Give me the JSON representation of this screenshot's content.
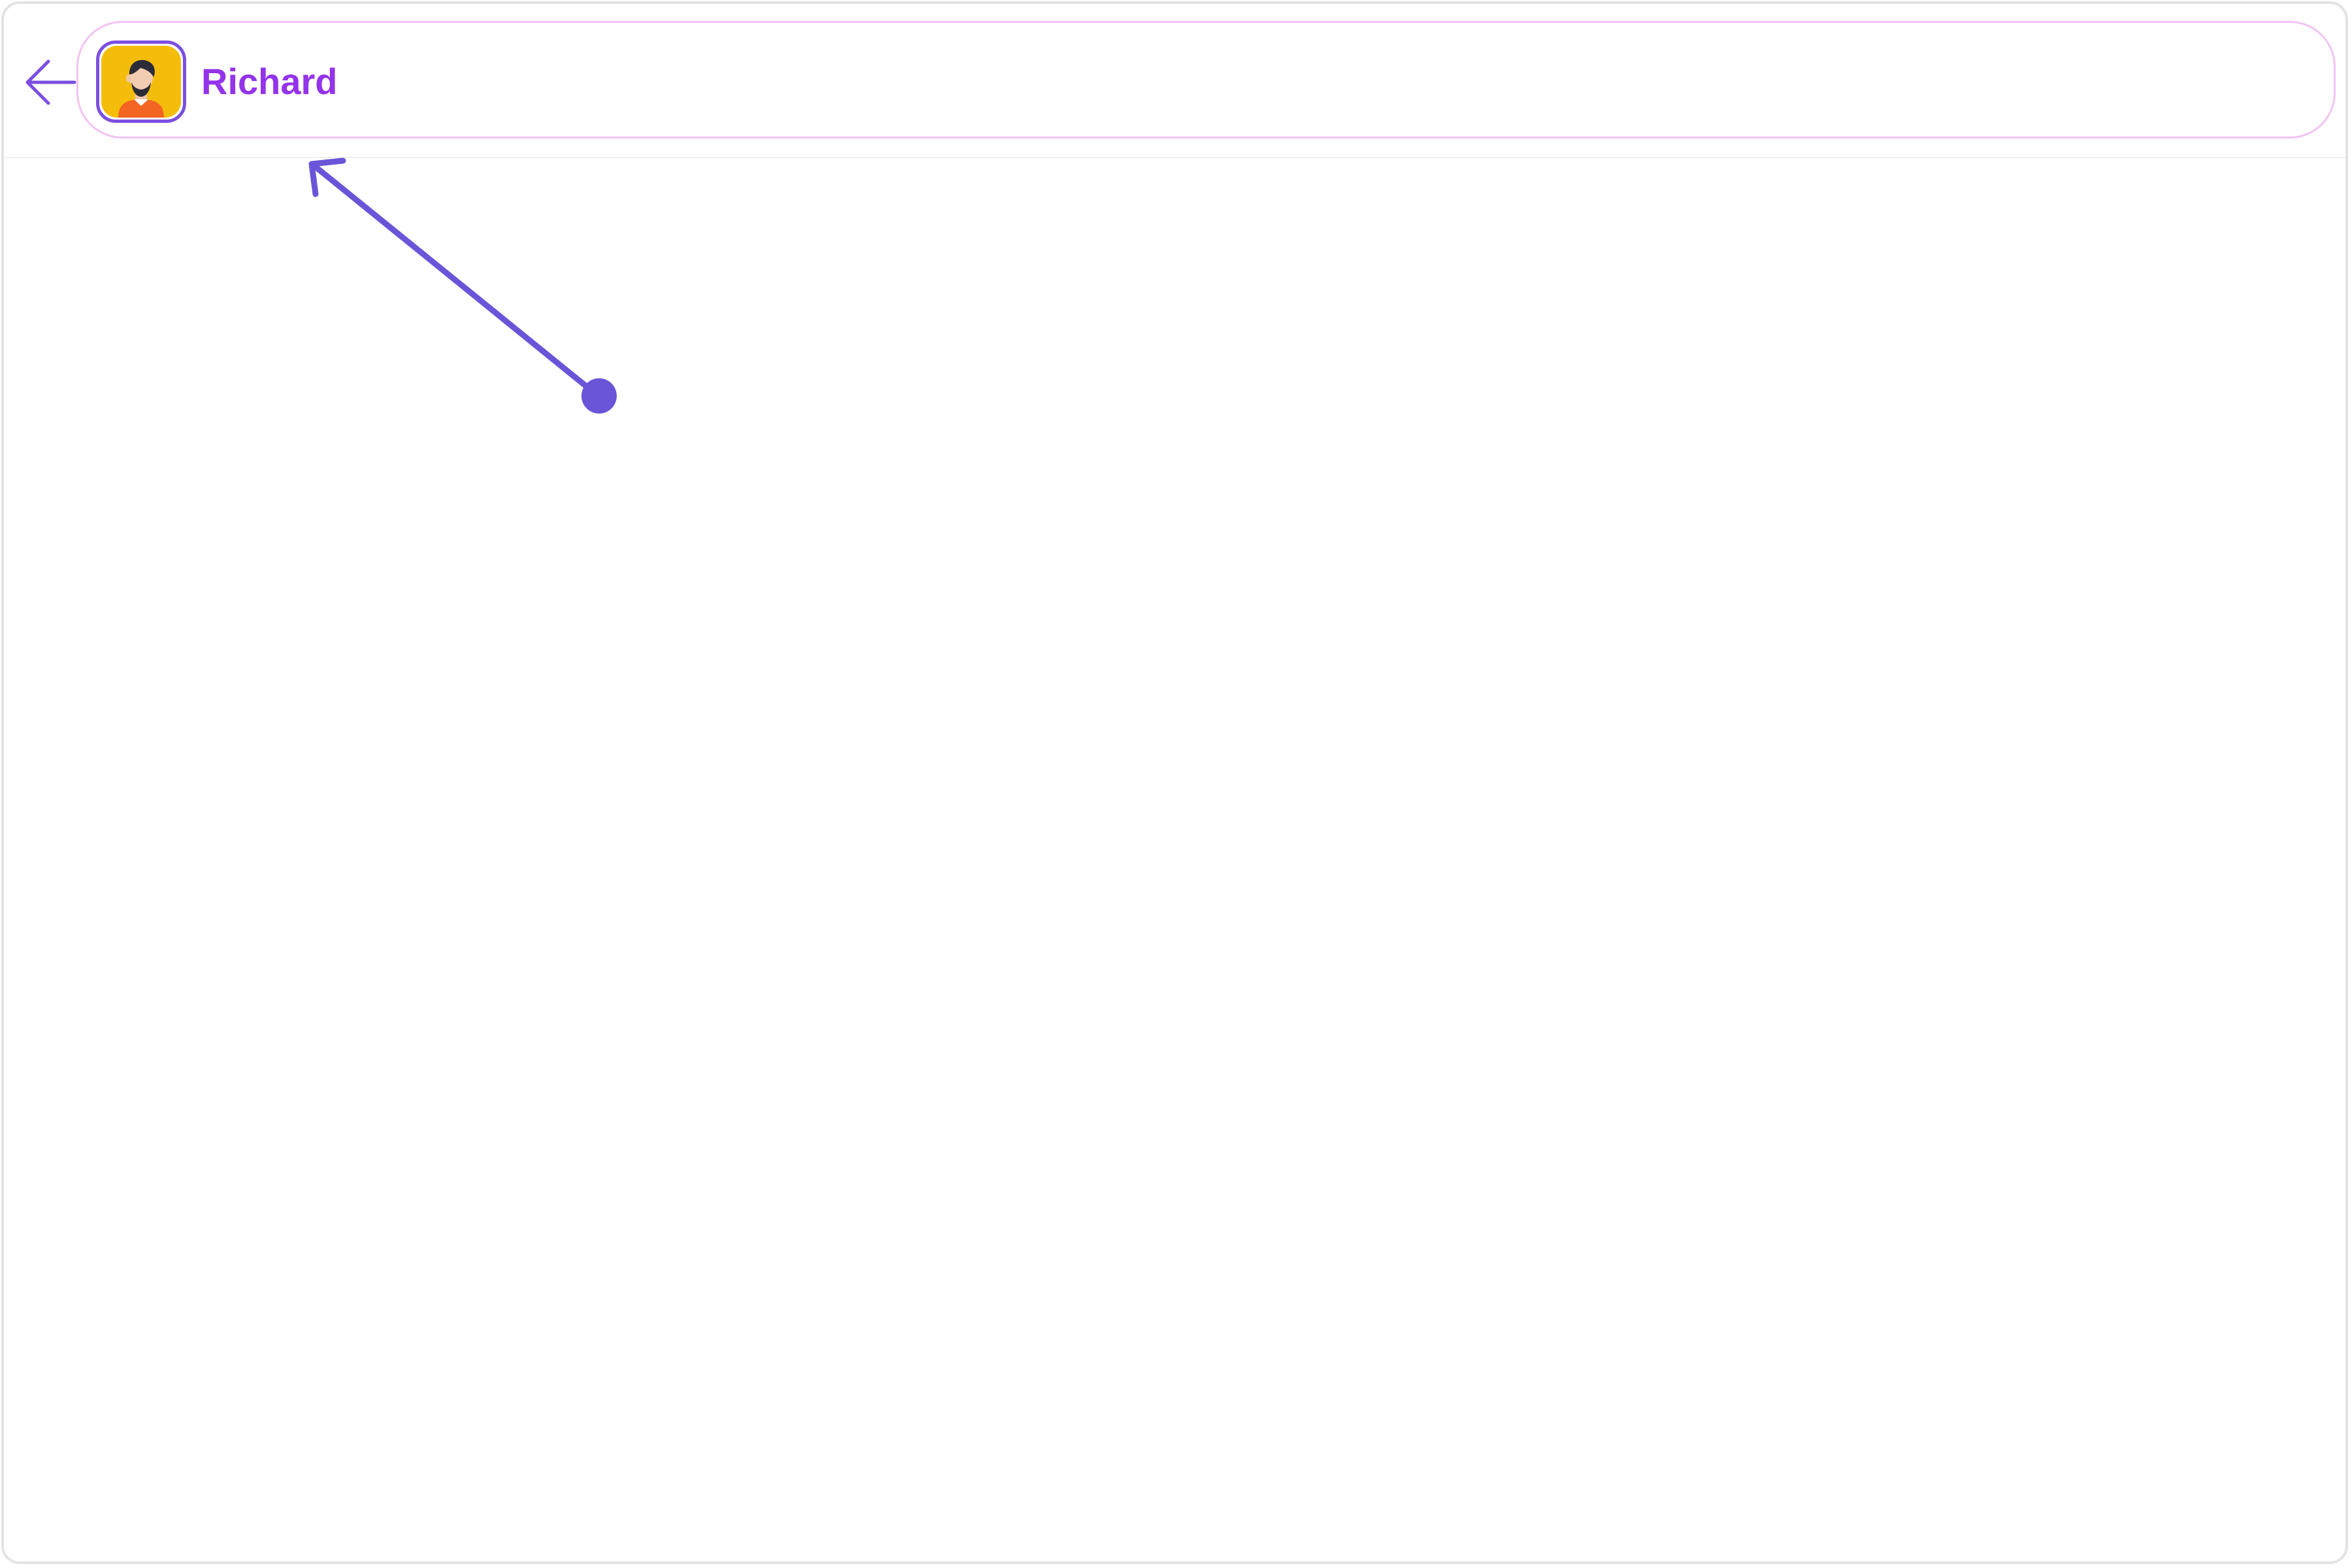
{
  "header": {
    "back_icon": "arrow-left-icon",
    "user": {
      "name": "Richard",
      "avatar_icon": "user-avatar-icon"
    }
  },
  "annotation": {
    "icon": "pointer-arrow-icon"
  },
  "colors": {
    "accent": "#7b4fe0",
    "name_text": "#9333ea",
    "pill_border": "#f2c4f2",
    "annotation": "#6a55d8",
    "avatar_bg": "#f5bd0b",
    "frame_border": "#e3e3e3"
  }
}
